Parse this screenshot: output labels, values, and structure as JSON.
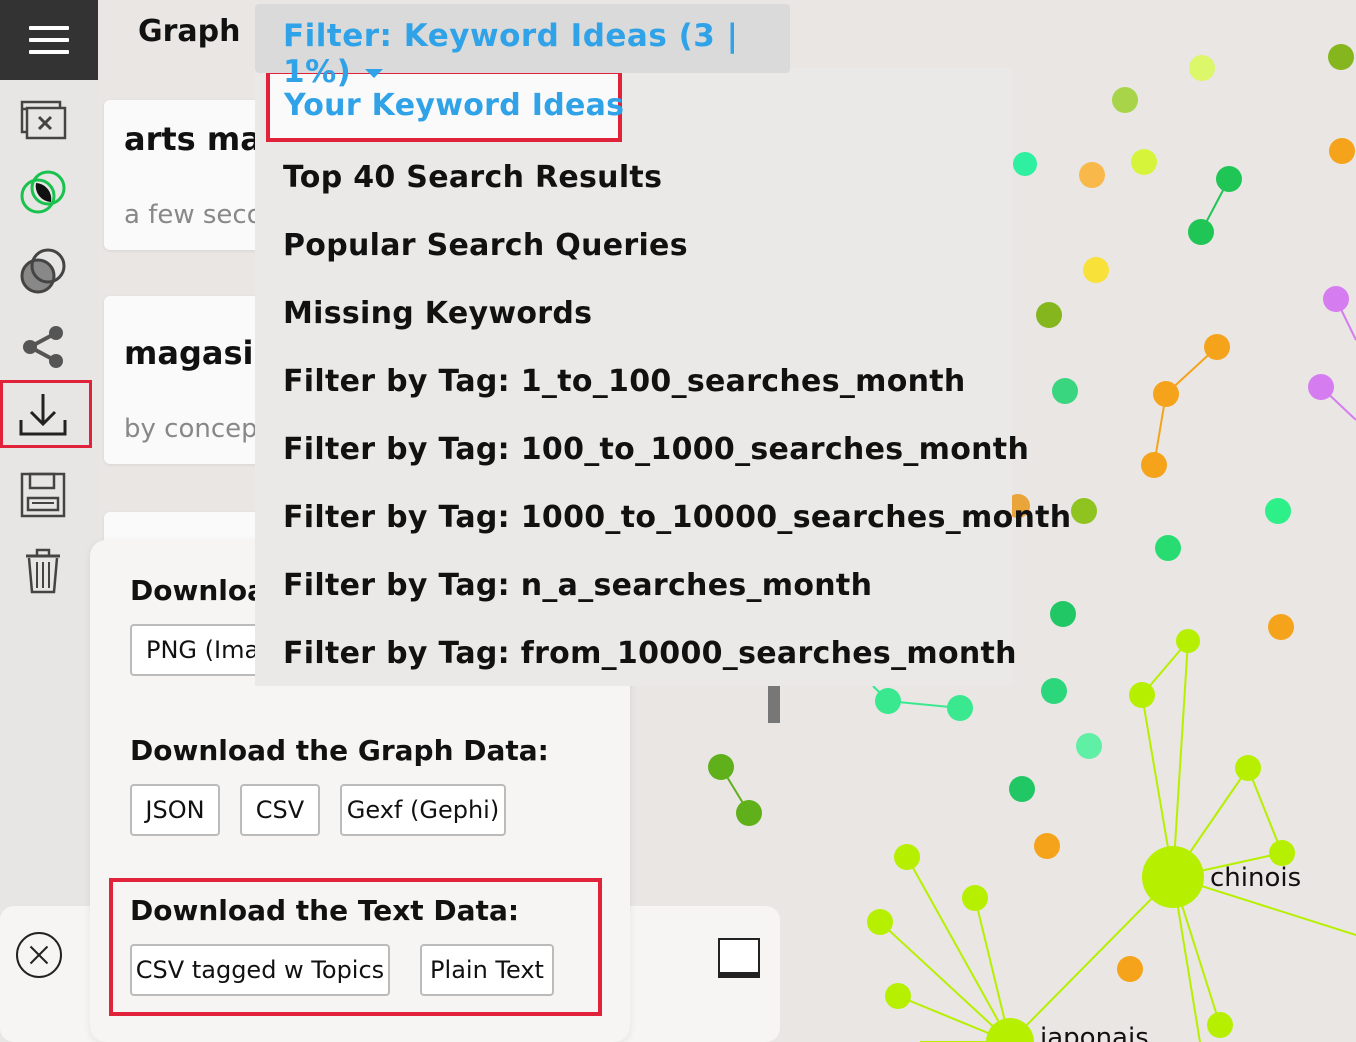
{
  "header": {
    "graph_tab": "Graph",
    "filter_label": "Filter: Keyword Ideas (3 | 1%)"
  },
  "sidebar": {
    "items": [
      {
        "icon": "menu-icon"
      },
      {
        "icon": "window-close-icon"
      },
      {
        "icon": "overlap-green-icon"
      },
      {
        "icon": "overlap-circles-icon"
      },
      {
        "icon": "share-icon"
      },
      {
        "icon": "download-icon"
      },
      {
        "icon": "save-icon"
      },
      {
        "icon": "trash-icon"
      }
    ]
  },
  "cards": [
    {
      "title": "arts mar",
      "subtitle": "a few seco"
    },
    {
      "title": "magasin",
      "subtitle": "by concep"
    }
  ],
  "dropdown": {
    "items": [
      "Your Keyword Ideas",
      "Top 40 Search Results",
      "Popular Search Queries",
      "Missing Keywords",
      "Filter by Tag: 1_to_100_searches_month",
      "Filter by Tag: 100_to_1000_searches_month",
      "Filter by Tag: 1000_to_10000_searches_month",
      "Filter by Tag: n_a_searches_month",
      "Filter by Tag: from_10000_searches_month"
    ]
  },
  "download_panel": {
    "image_heading": "Download",
    "image_button": "PNG (Imag",
    "graph_heading": "Download the Graph Data:",
    "graph_buttons": [
      "JSON",
      "CSV",
      "Gexf (Gephi)"
    ],
    "text_heading": "Download the Text Data:",
    "text_buttons": [
      "CSV tagged w Topics",
      "Plain Text"
    ]
  },
  "graph": {
    "labels": [
      "chinois",
      "japonais"
    ]
  },
  "colors": {
    "accent": "#2fa2e8",
    "highlight": "#e0223b"
  }
}
